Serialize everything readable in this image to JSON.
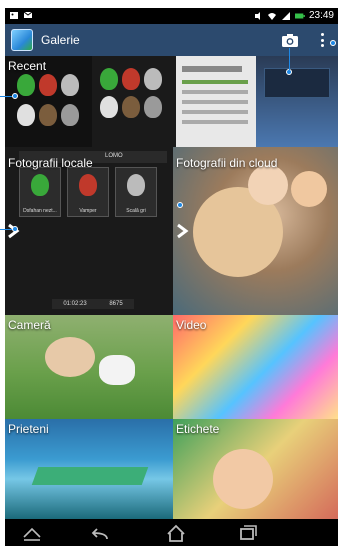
{
  "status_bar": {
    "time": "23:49",
    "icons": [
      "image-icon",
      "mail-icon",
      "mute-icon",
      "wifi-icon",
      "signal-icon",
      "battery-icon"
    ]
  },
  "action_bar": {
    "title": "Galerie",
    "camera_icon": "camera-icon",
    "menu_icon": "more-vertical-icon",
    "bg_color": "#2c4a6e"
  },
  "tiles": [
    {
      "label": "Recent"
    },
    {
      "label": "Fotografii locale"
    },
    {
      "label": "Fotografii din cloud"
    },
    {
      "label": "Cameră"
    },
    {
      "label": "Video"
    },
    {
      "label": "Prieteni"
    },
    {
      "label": "Etichete"
    }
  ],
  "local_thumbs": [
    {
      "caption": "Dsfahan nezt..."
    },
    {
      "caption": "Vamper"
    },
    {
      "caption": "Scală gri"
    }
  ],
  "local_lomo_label": "LOMO",
  "local_counts": {
    "video_duration": "01:02:23",
    "photo_count": "8675"
  },
  "nav_icons": [
    "home-collapse-icon",
    "back-icon",
    "home-icon",
    "recent-apps-icon"
  ]
}
